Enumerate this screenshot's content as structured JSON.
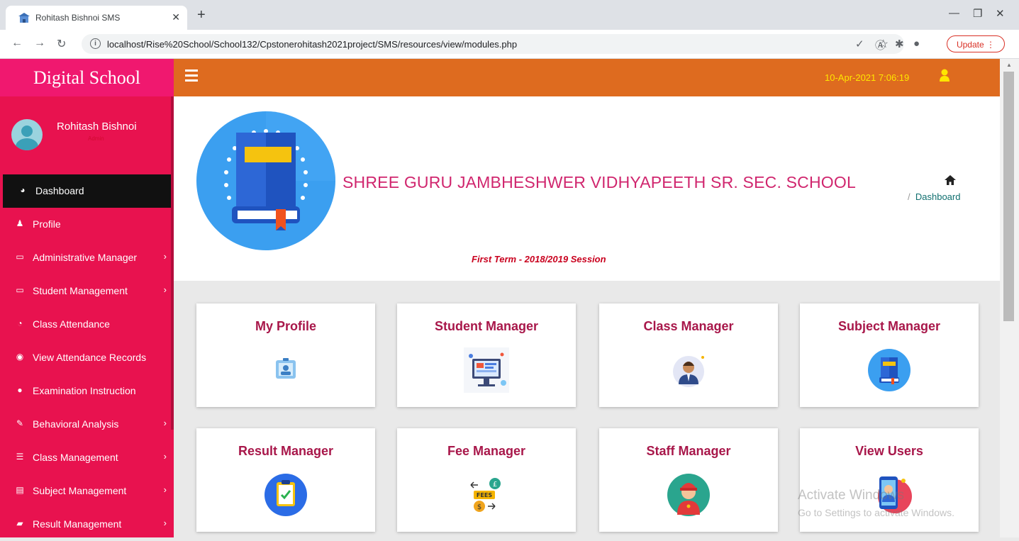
{
  "browser": {
    "tab_title": "Rohitash Bishnoi SMS",
    "url": "localhost/Rise%20School/School132/Cpstonerohitash2021project/SMS/resources/view/modules.php",
    "update_label": "Update"
  },
  "app": {
    "brand": "Digital School",
    "user": {
      "name": "Rohitash Bishnoi",
      "role": "Admin"
    },
    "datetime": "10-Apr-2021 7:06:19"
  },
  "sidebar": {
    "items": [
      {
        "label": "Dashboard",
        "icon": "dashboard-icon"
      },
      {
        "label": "Profile",
        "icon": "user-icon"
      },
      {
        "label": "Administrative Manager",
        "icon": "laptop-icon"
      },
      {
        "label": "Student Management",
        "icon": "laptop-icon"
      },
      {
        "label": "Class Attendance",
        "icon": "pie-chart-icon"
      },
      {
        "label": "View Attendance Records",
        "icon": "eye-icon"
      },
      {
        "label": "Examination Instruction",
        "icon": "comment-icon"
      },
      {
        "label": "Behavioral Analysis",
        "icon": "edit-icon"
      },
      {
        "label": "Class Management",
        "icon": "list-icon"
      },
      {
        "label": "Subject Management",
        "icon": "file-icon"
      },
      {
        "label": "Result Management",
        "icon": "book-icon"
      }
    ]
  },
  "header": {
    "school_name": "SHREE GURU JAMBHESHWER VIDHYAPEETH SR. SEC. SCHOOL",
    "term": "First Term - 2018/2019 Session",
    "breadcrumb_sep": "/",
    "breadcrumb": "Dashboard"
  },
  "cards": [
    {
      "title": "My Profile",
      "icon": "id-badge-icon"
    },
    {
      "title": "Student Manager",
      "icon": "computer-illustration-icon"
    },
    {
      "title": "Class Manager",
      "icon": "teacher-avatar-icon"
    },
    {
      "title": "Subject Manager",
      "icon": "book-icon"
    },
    {
      "title": "Result Manager",
      "icon": "clipboard-check-icon"
    },
    {
      "title": "Fee Manager",
      "icon": "fees-money-icon"
    },
    {
      "title": "Staff Manager",
      "icon": "staff-avatar-icon"
    },
    {
      "title": "View Users",
      "icon": "phone-user-icon"
    }
  ],
  "watermark": {
    "line1": "Activate Windows",
    "line2": "Go to Settings to activate Windows."
  }
}
